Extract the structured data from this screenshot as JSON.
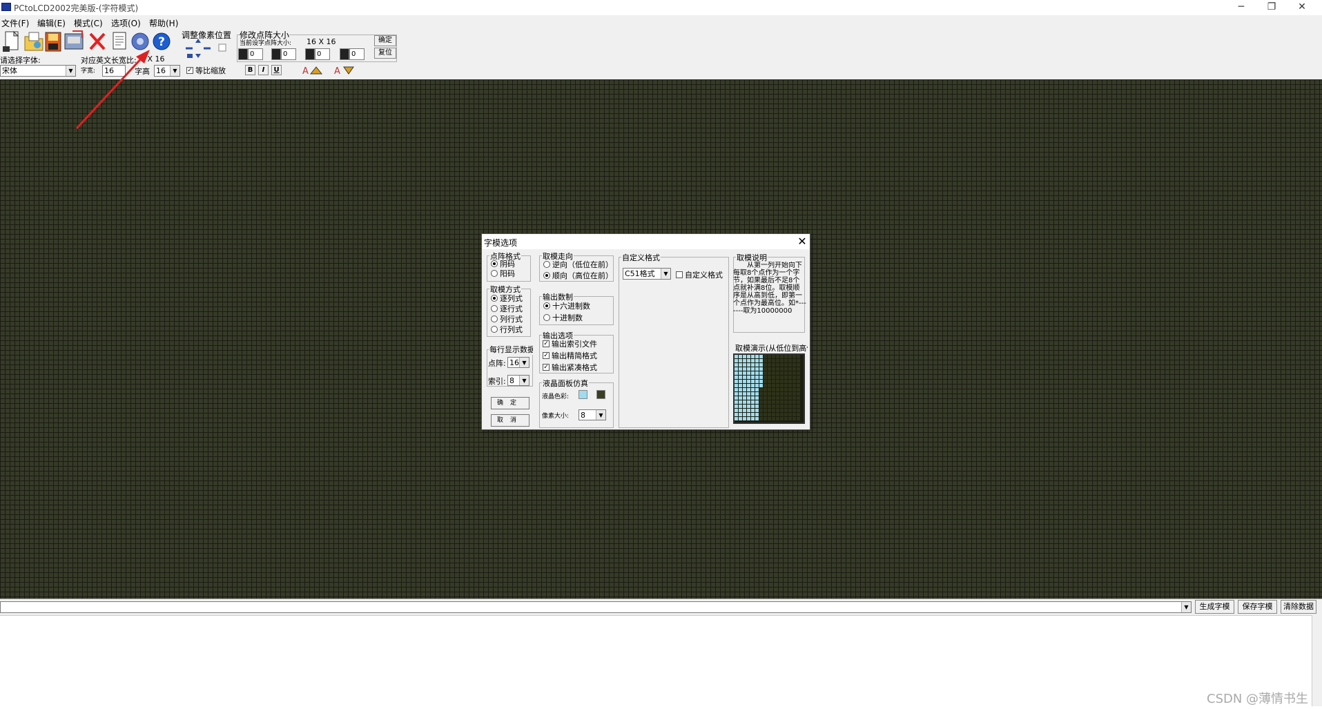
{
  "window": {
    "title": "PCtoLCD2002完美版-(字符模式)",
    "minimize": "─",
    "restore": "❐",
    "close": "✕"
  },
  "menu": [
    "文件(F)",
    "编辑(E)",
    "模式(C)",
    "选项(O)",
    "帮助(H)"
  ],
  "toolbar": {
    "icons": [
      "new-file-icon",
      "open-folder-icon",
      "save-icon",
      "save-as-icon",
      "delete-x-icon",
      "document-icon",
      "settings-gear-icon",
      "help-icon"
    ],
    "pixel_adjust_label": "调整像素位置",
    "dotsize_label": "修改点阵大小",
    "current_size_label": "当前设字点阵大小:",
    "current_size_value": "16 X 16",
    "confirm_btn": "确定",
    "reset_btn": "复位",
    "spin_values": [
      "0",
      "0",
      "0",
      "0"
    ],
    "font_select_label": "请选择字体:",
    "font_value": "宋体",
    "en_ratio_label": "对应英文长宽比:",
    "en_ratio_value": "8 X 16",
    "width_label": "字宽:",
    "width_value": "16",
    "height_label": "字高",
    "height_value": "16",
    "proportional_label": "等比缩放",
    "proportional_checked": true,
    "bold": "B",
    "italic": "I",
    "underline": "U"
  },
  "grid": {
    "background_color": "#363a28",
    "line_color": "#1a1c10"
  },
  "bottom": {
    "generate_btn": "生成字模",
    "save_btn": "保存字模",
    "clear_btn": "清除数据"
  },
  "watermark": "CSDN @薄情书生",
  "dialog": {
    "title": "字模选项",
    "close": "✕",
    "dot_format": {
      "title": "点阵格式",
      "options": [
        "阴码",
        "阳码"
      ],
      "selected": "阴码"
    },
    "scan_mode": {
      "title": "取模方式",
      "options": [
        "逐列式",
        "逐行式",
        "列行式",
        "行列式"
      ],
      "selected": "逐列式"
    },
    "per_line": {
      "title": "每行显示数据",
      "dot_label": "点阵:",
      "dot_value": "16",
      "index_label": "索引:",
      "index_value": "8"
    },
    "confirm_btn": "确定",
    "cancel_btn": "取消",
    "direction": {
      "title": "取模走向",
      "options": [
        "逆向（低位在前）",
        "顺向（高位在前）"
      ],
      "selected": "顺向（高位在前）"
    },
    "number_base": {
      "title": "输出数制",
      "options": [
        "十六进制数",
        "十进制数"
      ],
      "selected": "十六进制数"
    },
    "output_options": {
      "title": "输出选项",
      "items": [
        {
          "label": "输出索引文件",
          "checked": true
        },
        {
          "label": "输出精简格式",
          "checked": true
        },
        {
          "label": "输出紧凑格式",
          "checked": true
        }
      ]
    },
    "lcd_sim": {
      "title": "液晶面板仿真",
      "color_label": "液晶色彩:",
      "color_on": "#9fdcef",
      "color_off": "#3a3e24",
      "pixel_size_label": "像素大小:",
      "pixel_size_value": "8"
    },
    "custom_format": {
      "title": "自定义格式",
      "format_value": "C51格式",
      "custom_checkbox_label": "自定义格式",
      "custom_checked": false
    },
    "description": {
      "title": "取模说明",
      "text": "从第一列开始向下每取8个点作为一个字节，如果最后不足8个点就补满8位。取模顺序是从高到低，即第一个点作为最高位。如*-------取为10000000"
    },
    "demo": {
      "title": "取模演示(从低位到高位)"
    }
  }
}
